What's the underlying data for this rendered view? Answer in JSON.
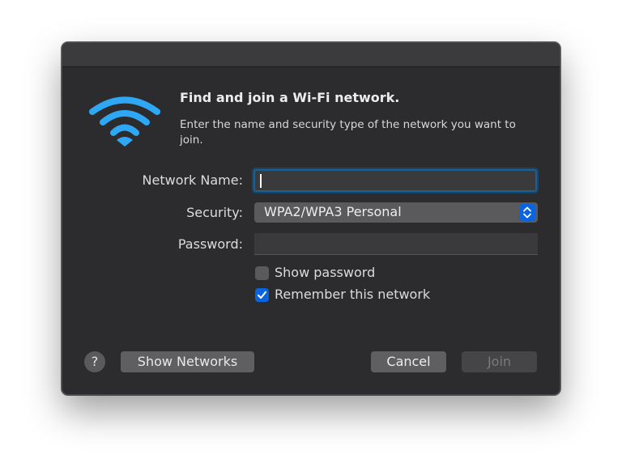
{
  "dialog": {
    "heading": "Find and join a Wi-Fi network.",
    "description": "Enter the name and security type of the network you want to join.",
    "icon": "wifi-icon",
    "accent_color": "#0a64e0",
    "wifi_color": "#2ea8f5"
  },
  "form": {
    "network_name_label": "Network Name:",
    "network_name_value": "",
    "security_label": "Security:",
    "security_value": "WPA2/WPA3 Personal",
    "password_label": "Password:",
    "password_value": ""
  },
  "checkboxes": {
    "show_password": {
      "label": "Show password",
      "checked": false
    },
    "remember_network": {
      "label": "Remember this network",
      "checked": true
    }
  },
  "buttons": {
    "help": "?",
    "show_networks": "Show Networks",
    "cancel": "Cancel",
    "join": "Join",
    "join_enabled": false
  }
}
